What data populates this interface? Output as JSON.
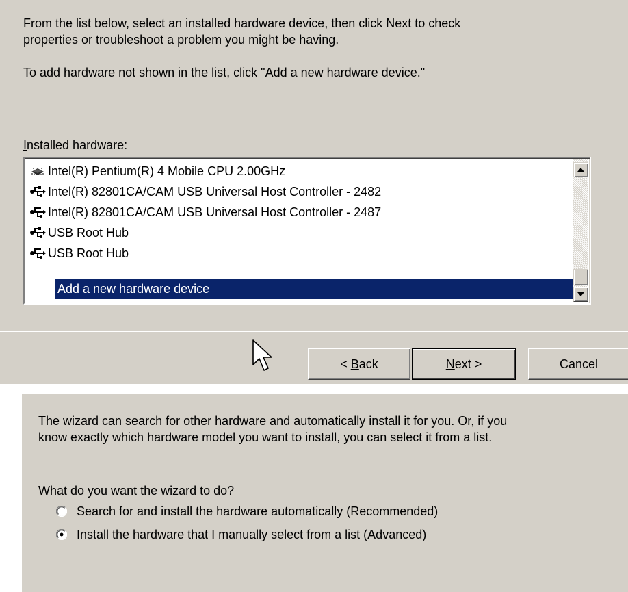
{
  "top_dialog": {
    "intro_line1": "From the list below, select an installed hardware device, then click Next to check",
    "intro_line2": "properties or troubleshoot a problem you might be having.",
    "add_hint": "To add hardware not shown in the list, click \"Add a new hardware device.\"",
    "installed_label_mnemonic": "I",
    "installed_label_rest": "nstalled hardware:",
    "devices": [
      {
        "label": "Intel(R) Pentium(R) 4 Mobile CPU 2.00GHz",
        "icon": "processor-chip-icon"
      },
      {
        "label": "Intel(R) 82801CA/CAM USB Universal Host Controller - 2482",
        "icon": "usb-icon"
      },
      {
        "label": "Intel(R) 82801CA/CAM USB Universal Host Controller - 2487",
        "icon": "usb-icon"
      },
      {
        "label": "USB Root Hub",
        "icon": "usb-icon"
      },
      {
        "label": "USB Root Hub",
        "icon": "usb-icon"
      },
      {
        "label": "Add a new hardware device",
        "selected": true
      }
    ],
    "buttons": {
      "back_prefix": "< ",
      "back_mnemonic": "B",
      "back_rest": "ack",
      "next_mnemonic": "N",
      "next_rest": "ext >",
      "cancel": "Cancel"
    }
  },
  "bottom_dialog": {
    "description_line1": "The wizard can search for other hardware and automatically install it for you. Or, if you",
    "description_line2": "know exactly which hardware model you want to install, you can select it from a list.",
    "question": "What do you want the wizard to do?",
    "options": [
      {
        "label": "Search for and install the hardware automatically (Recommended)",
        "checked": false
      },
      {
        "label": "Install the hardware that I manually select from a list (Advanced)",
        "checked": true
      }
    ]
  },
  "colors": {
    "dialog_bg": "#d4d0c8",
    "selection_bg": "#0a246a",
    "selection_text": "#ffffff"
  }
}
